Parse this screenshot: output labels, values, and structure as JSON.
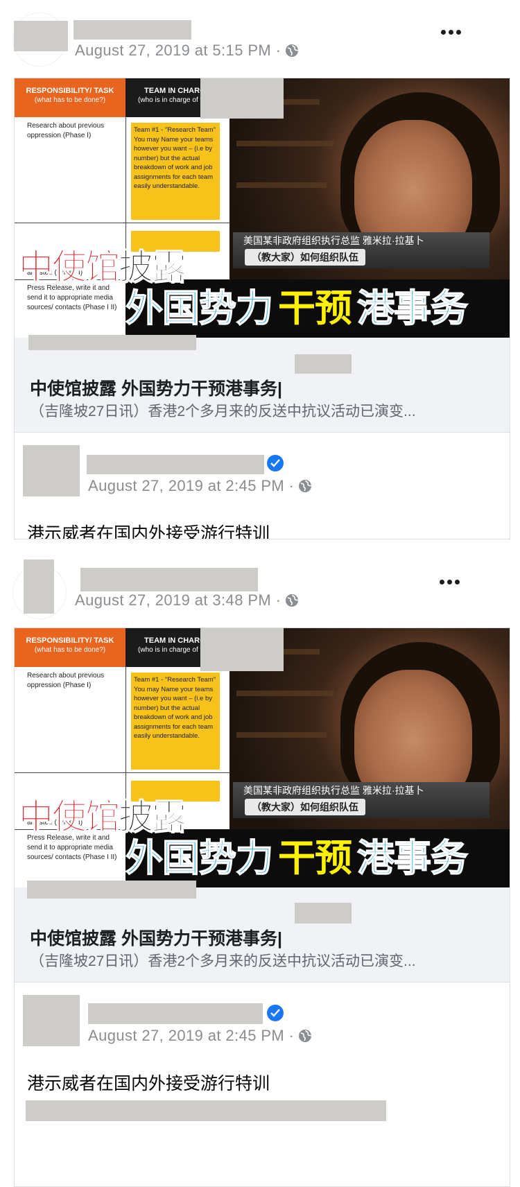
{
  "posts": [
    {
      "timestamp": "August 27, 2019 at 5:15 PM ·",
      "shared": {
        "doc_header_task": "RESPONSIBILITY/ TASK",
        "doc_header_task_sub": "(what has to be done?)",
        "doc_header_team": "TEAM IN CHARGE",
        "doc_header_team_sub": "(who is in charge of this?)",
        "doc_row1": "Research about previous oppression (Phase I)",
        "doc_yellow": "Team #1 - \"Research Team\" You may Name your teams however you want – (i.e by number) but the actual breakdown of work and job assignments for each team easily understandable.",
        "doc_row_mid": "arrested (Phase I)",
        "doc_row3": "Press Release, write it and send it to appropriate media sources/ contacts (Phase I II)",
        "news_line1": "美国某非政府组织执行总监 雅米拉·拉基卜",
        "news_line2": "（教大家）如何组织队伍",
        "headline_red": "中使馆",
        "headline_black": "披露",
        "headline_blue1": "外国势力",
        "headline_yellow": "干预",
        "headline_blue2": "港事务",
        "link_title": "中使馆披露 外国势力干预港事务|",
        "link_desc": "（吉隆坡27日讯）香港2个多月来的反送中抗议活动已演变..."
      },
      "inner_timestamp": "August 27, 2019 at 2:45 PM ·",
      "inner_text": "港示威者在国内外接受游行特训"
    },
    {
      "timestamp": "August 27, 2019 at 3:48 PM ·",
      "shared": {
        "doc_header_task": "RESPONSIBILITY/ TASK",
        "doc_header_task_sub": "(what has to be done?)",
        "doc_header_team": "TEAM IN CHARGE",
        "doc_header_team_sub": "(who is in charge of this?)",
        "doc_row1": "Research about previous oppression (Phase I)",
        "doc_yellow": "Team #1 - \"Research Team\" You may Name your teams however you want – (i.e by number) but the actual breakdown of work and job assignments for each team easily understandable.",
        "doc_row_mid": "arrested (Phase I)",
        "doc_row3": "Press Release, write it and send it to appropriate media sources/ contacts (Phase I II)",
        "news_line1": "美国某非政府组织执行总监 雅米拉·拉基卜",
        "news_line2": "（教大家）如何组织队伍",
        "headline_red": "中使馆",
        "headline_black": "披露",
        "headline_blue1": "外国势力",
        "headline_yellow": "干预",
        "headline_blue2": "港事务",
        "link_title": "中使馆披露 外国势力干预港事务|",
        "link_desc": "（吉隆坡27日讯）香港2个多月来的反送中抗议活动已演变..."
      },
      "inner_timestamp": "August 27, 2019 at 2:45 PM ·",
      "inner_text": "港示威者在国内外接受游行特训"
    }
  ],
  "colors": {
    "redaction": "#cdccc8",
    "meta_gray": "#8a8d91",
    "verified_blue": "#1877f2",
    "link_bg": "#f0f2f5"
  },
  "icons": [
    "globe-icon",
    "more-options-icon",
    "verified-badge-icon"
  ]
}
